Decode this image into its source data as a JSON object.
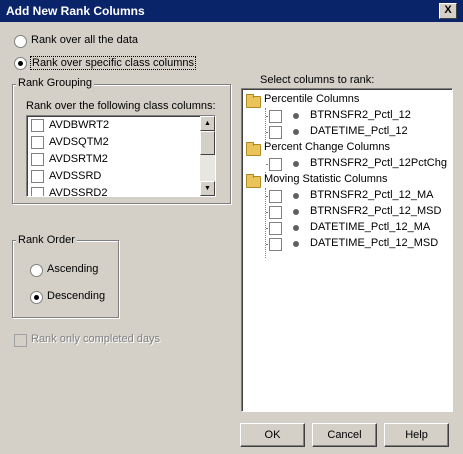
{
  "window": {
    "title": "Add New Rank Columns",
    "close_label": "X"
  },
  "scope": {
    "option_all": "Rank over all the data",
    "option_specific": "Rank over specific class columns",
    "selected": "specific"
  },
  "grouping": {
    "title": "Rank Grouping",
    "caption": "Rank over the following class columns:",
    "items": [
      "AVDBWRT2",
      "AVDSQTM2",
      "AVDSRTM2",
      "AVDSSRD",
      "AVDSSRD2"
    ]
  },
  "order": {
    "title": "Rank Order",
    "ascending": "Ascending",
    "descending": "Descending",
    "selected": "descending"
  },
  "completed_days": {
    "label": "Rank only completed days",
    "enabled": false
  },
  "columns": {
    "caption": "Select columns to rank:",
    "groups": [
      {
        "name": "Percentile Columns",
        "items": [
          "BTRNSFR2_Pctl_12",
          "DATETIME_Pctl_12"
        ]
      },
      {
        "name": "Percent Change Columns",
        "items": [
          "BTRNSFR2_Pctl_12PctChg"
        ]
      },
      {
        "name": "Moving Statistic Columns",
        "items": [
          "BTRNSFR2_Pctl_12_MA",
          "BTRNSFR2_Pctl_12_MSD",
          "DATETIME_Pctl_12_MA",
          "DATETIME_Pctl_12_MSD"
        ]
      }
    ]
  },
  "buttons": {
    "ok": "OK",
    "cancel": "Cancel",
    "help": "Help"
  }
}
